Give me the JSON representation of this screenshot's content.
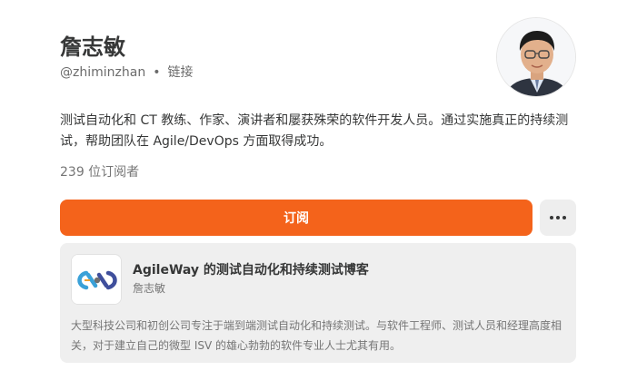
{
  "profile": {
    "name": "詹志敏",
    "handle": "@zhiminzhan",
    "separator": "•",
    "link_label": "链接",
    "bio": "测试自动化和 CT 教练、作家、演讲者和屡获殊荣的软件开发人员。通过实施真正的持续测试，帮助团队在 Agile/DevOps 方面取得成功。",
    "subscriber_count": "239 位订阅者"
  },
  "actions": {
    "subscribe_label": "订阅",
    "more_icon": "more-horizontal-icon"
  },
  "publication": {
    "title": "AgileWay 的测试自动化和持续测试博客",
    "author": "詹志敏",
    "description": "大型科技公司和初创公司专注于端到端测试自动化和持续测试。与软件工程师、测试人员和经理高度相关，对于建立自己的微型 ISV 的雄心勃勃的软件专业人士尤其有用。",
    "logo_icon": "agileway-logo-icon"
  },
  "colors": {
    "accent": "#f4631b",
    "text": "#363737",
    "muted": "#757575",
    "box_bg": "#efefef"
  }
}
